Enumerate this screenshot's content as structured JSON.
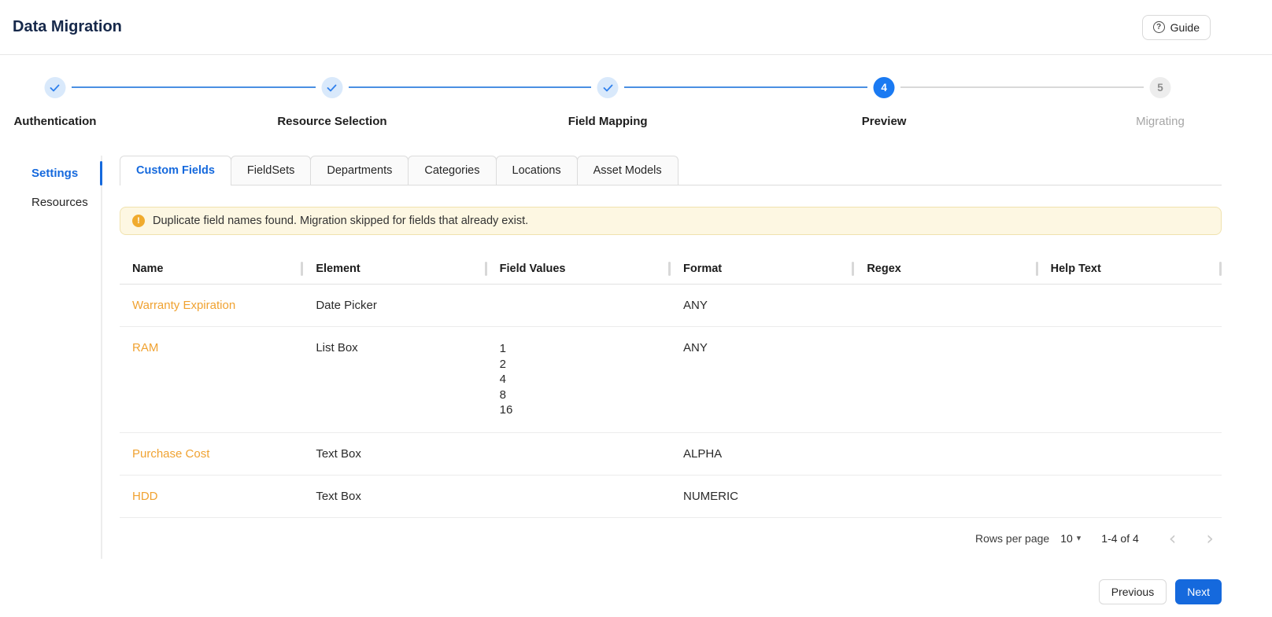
{
  "header": {
    "title": "Data Migration",
    "guide_label": "Guide"
  },
  "icons": {
    "question": "?",
    "warning": "!",
    "caret_down": "▾",
    "chevron_left": "‹",
    "chevron_right": "›"
  },
  "stepper": {
    "steps": [
      {
        "label": "Authentication",
        "status": "complete"
      },
      {
        "label": "Resource Selection",
        "status": "complete"
      },
      {
        "label": "Field Mapping",
        "status": "complete"
      },
      {
        "label": "Preview",
        "status": "active",
        "number": "4"
      },
      {
        "label": "Migrating",
        "status": "upcoming",
        "number": "5"
      }
    ]
  },
  "sidebar": {
    "items": [
      {
        "label": "Settings",
        "active": true
      },
      {
        "label": "Resources",
        "active": false
      }
    ]
  },
  "tabs": [
    {
      "label": "Custom Fields",
      "active": true
    },
    {
      "label": "FieldSets",
      "active": false
    },
    {
      "label": "Departments",
      "active": false
    },
    {
      "label": "Categories",
      "active": false
    },
    {
      "label": "Locations",
      "active": false
    },
    {
      "label": "Asset Models",
      "active": false
    }
  ],
  "banner": {
    "text": "Duplicate field names found. Migration skipped for fields that already exist."
  },
  "table": {
    "columns": [
      "Name",
      "Element",
      "Field Values",
      "Format",
      "Regex",
      "Help Text"
    ],
    "rows": [
      {
        "name": "Warranty Expiration",
        "element": "Date Picker",
        "field_values": "",
        "format": "ANY",
        "regex": "",
        "help_text": ""
      },
      {
        "name": "RAM",
        "element": "List Box",
        "field_values": "1\n2\n4\n8\n16",
        "format": "ANY",
        "regex": "",
        "help_text": ""
      },
      {
        "name": "Purchase Cost",
        "element": "Text Box",
        "field_values": "",
        "format": "ALPHA",
        "regex": "",
        "help_text": ""
      },
      {
        "name": "HDD",
        "element": "Text Box",
        "field_values": "",
        "format": "NUMERIC",
        "regex": "",
        "help_text": ""
      }
    ],
    "pagination": {
      "rows_per_page_label": "Rows per page",
      "rows_per_page_value": "10",
      "range_label": "1-4 of 4"
    }
  },
  "footer": {
    "previous_label": "Previous",
    "next_label": "Next"
  },
  "colors": {
    "primary": "#1569dd",
    "active_step": "#1a7af2",
    "check_blue": "#2f80ed",
    "line_blue": "#4a8fe2",
    "orange_link": "#f0a231",
    "banner_bg": "#fdf7e2",
    "banner_border": "#f0e2ae",
    "warning_icon": "#f0ab2e",
    "title_navy": "#16284a"
  }
}
